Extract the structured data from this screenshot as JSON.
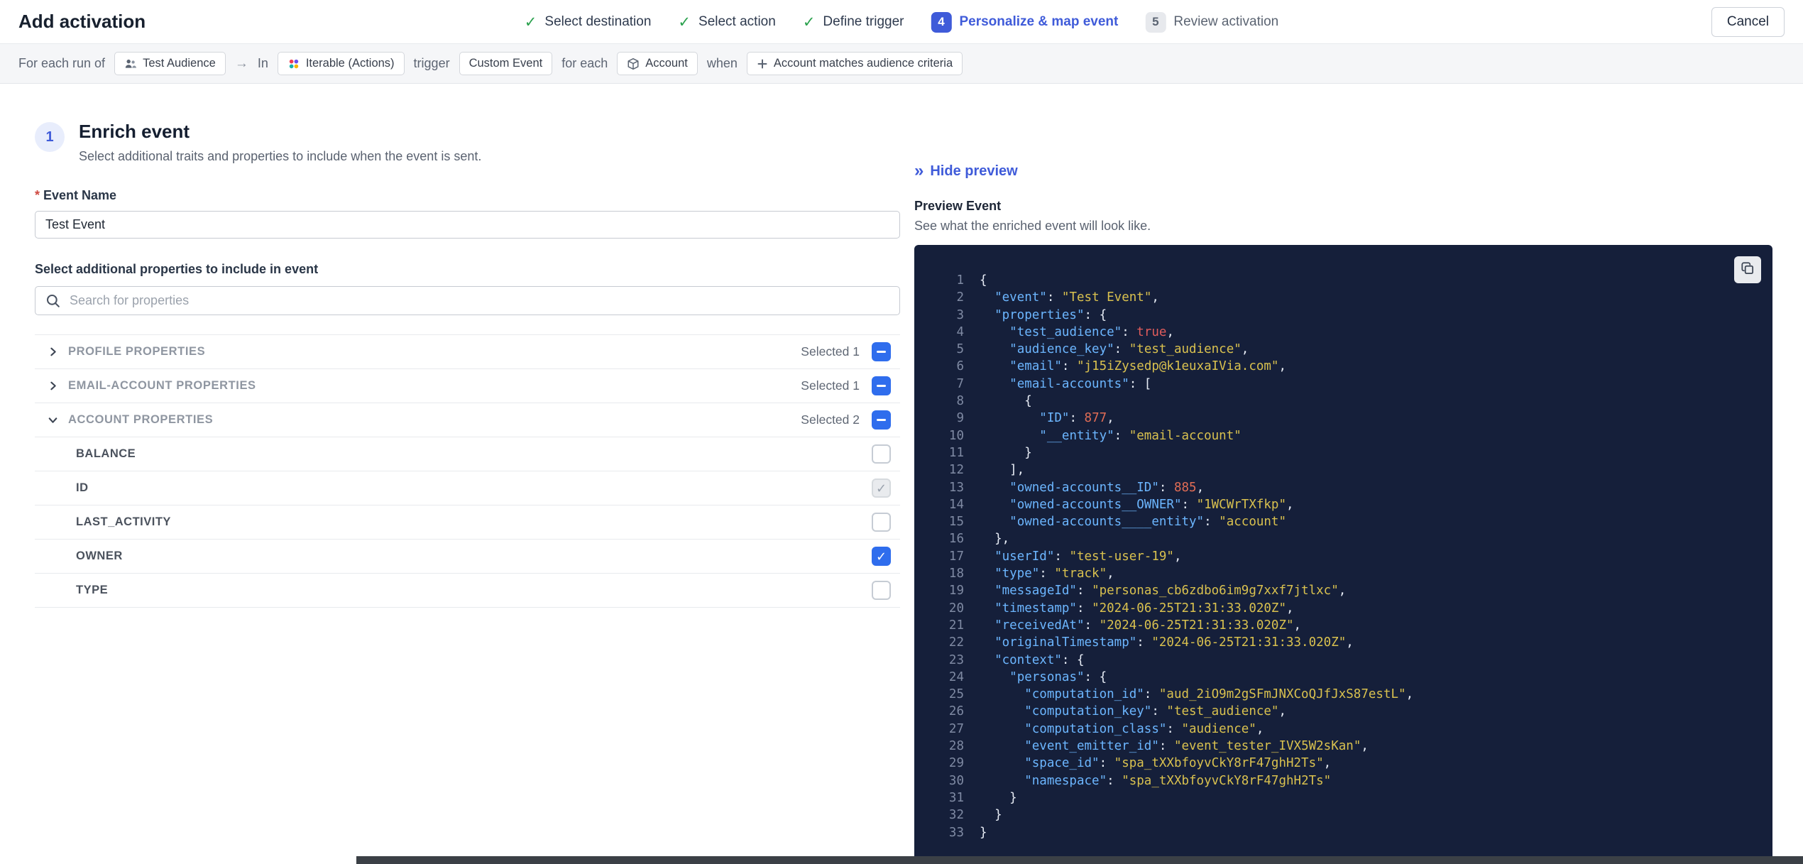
{
  "colors": {
    "accent": "#3f5bd9",
    "checkbox_blue": "#2f6ded",
    "success_green": "#2aa14d",
    "code_bg": "#151f3a",
    "code_key": "#6cb6ff",
    "code_string": "#d9c14f",
    "code_number": "#e06c55",
    "code_bool": "#e05c5c"
  },
  "icons": {
    "search": "search-icon",
    "copy": "copy-icon",
    "hide_preview_glyph": "»",
    "arrow_glyph": "→"
  },
  "header": {
    "title": "Add activation",
    "cancel_label": "Cancel",
    "steps": [
      {
        "label": "Select destination",
        "state": "done"
      },
      {
        "label": "Select action",
        "state": "done"
      },
      {
        "label": "Define trigger",
        "state": "done"
      },
      {
        "number": "4",
        "label": "Personalize & map event",
        "state": "active"
      },
      {
        "number": "5",
        "label": "Review activation",
        "state": "upcoming"
      }
    ]
  },
  "trigger_bar": {
    "segments": [
      {
        "type": "text",
        "text": "For each run of"
      },
      {
        "type": "chip",
        "icon": "audience-icon",
        "text": "Test Audience"
      },
      {
        "type": "arrow",
        "text": "→"
      },
      {
        "type": "text",
        "text": "In"
      },
      {
        "type": "chip",
        "icon": "iterable-icon",
        "text": "Iterable (Actions)"
      },
      {
        "type": "text",
        "text": "trigger"
      },
      {
        "type": "chip",
        "text": "Custom Event"
      },
      {
        "type": "text",
        "text": "for each"
      },
      {
        "type": "chip",
        "icon": "cube-icon",
        "text": "Account"
      },
      {
        "type": "text",
        "text": "when"
      },
      {
        "type": "chip",
        "icon": "plus-icon",
        "text": "Account matches audience criteria"
      }
    ]
  },
  "enrich": {
    "step_number": "1",
    "title": "Enrich event",
    "subtitle": "Select additional traits and properties to include when the event is sent.",
    "required_marker": "*",
    "event_name_label": "Event Name",
    "event_name_value": "Test Event",
    "properties_label": "Select additional properties to include in event",
    "search_placeholder": "Search for properties",
    "sections": [
      {
        "label": "PROFILE PROPERTIES",
        "selected_text": "Selected 1",
        "expanded": false,
        "rows": []
      },
      {
        "label": "EMAIL-ACCOUNT PROPERTIES",
        "selected_text": "Selected 1",
        "expanded": false,
        "rows": []
      },
      {
        "label": "ACCOUNT PROPERTIES",
        "selected_text": "Selected 2",
        "expanded": true,
        "rows": [
          {
            "label": "BALANCE",
            "checked": false,
            "disabled": false
          },
          {
            "label": "ID",
            "checked": true,
            "disabled": true
          },
          {
            "label": "LAST_ACTIVITY",
            "checked": false,
            "disabled": false
          },
          {
            "label": "OWNER",
            "checked": true,
            "disabled": false
          },
          {
            "label": "TYPE",
            "checked": false,
            "disabled": false
          }
        ]
      }
    ]
  },
  "preview": {
    "hide_icon": "»",
    "hide_label": "Hide preview",
    "title": "Preview Event",
    "subtitle": "See what the enriched event will look like.",
    "code_lines": [
      "{",
      "  \"event\": \"Test Event\",",
      "  \"properties\": {",
      "    \"test_audience\": true,",
      "    \"audience_key\": \"test_audience\",",
      "    \"email\": \"j15iZysedp@k1euxaIVia.com\",",
      "    \"email-accounts\": [",
      "      {",
      "        \"ID\": 877,",
      "        \"__entity\": \"email-account\"",
      "      }",
      "    ],",
      "    \"owned-accounts__ID\": 885,",
      "    \"owned-accounts__OWNER\": \"1WCWrTXfkp\",",
      "    \"owned-accounts____entity\": \"account\"",
      "  },",
      "  \"userId\": \"test-user-19\",",
      "  \"type\": \"track\",",
      "  \"messageId\": \"personas_cb6zdbo6im9g7xxf7jtlxc\",",
      "  \"timestamp\": \"2024-06-25T21:31:33.020Z\",",
      "  \"receivedAt\": \"2024-06-25T21:31:33.020Z\",",
      "  \"originalTimestamp\": \"2024-06-25T21:31:33.020Z\",",
      "  \"context\": {",
      "    \"personas\": {",
      "      \"computation_id\": \"aud_2iO9m2gSFmJNXCoQJfJxS87estL\",",
      "      \"computation_key\": \"test_audience\",",
      "      \"computation_class\": \"audience\",",
      "      \"event_emitter_id\": \"event_tester_IVX5W2sKan\",",
      "      \"space_id\": \"spa_tXXbfoyvCkY8rF47ghH2Ts\",",
      "      \"namespace\": \"spa_tXXbfoyvCkY8rF47ghH2Ts\"",
      "    }",
      "  }",
      "}"
    ]
  }
}
